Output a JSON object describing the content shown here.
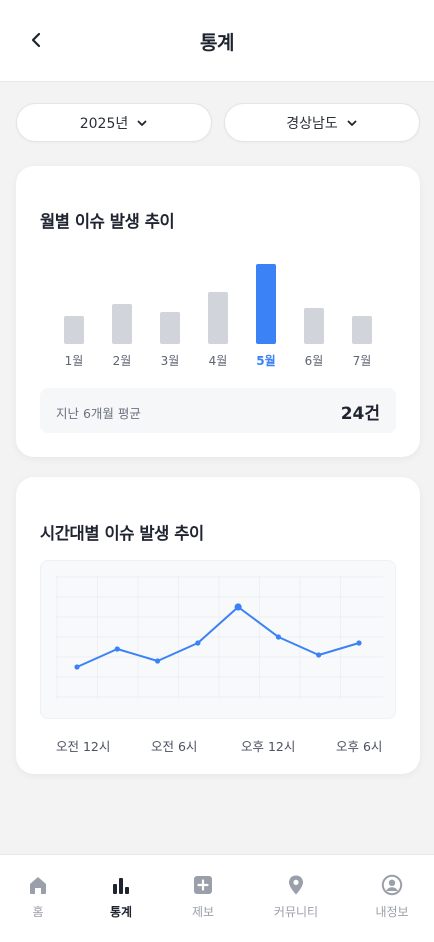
{
  "header": {
    "title": "통계"
  },
  "filters": {
    "year": "2025년",
    "region": "경상남도"
  },
  "monthly_card": {
    "title": "월별 이슈 발생 추이",
    "average_label": "지난 6개월 평균",
    "average_value": "24건"
  },
  "hourly_card": {
    "title": "시간대별 이슈 발생 추이"
  },
  "colors": {
    "accent": "#3b82f6",
    "bar_default": "#d1d5db",
    "month_label": "#5f6470"
  },
  "chart_data": [
    {
      "type": "bar",
      "categories": [
        "1월",
        "2월",
        "3월",
        "4월",
        "5월",
        "6월",
        "7월"
      ],
      "values": [
        14,
        20,
        16,
        26,
        40,
        18,
        14
      ],
      "highlighted": "5월",
      "ylim": [
        0,
        40
      ],
      "grid": false,
      "title": "월별 이슈 발생 추이",
      "xlabel": "",
      "ylabel": ""
    },
    {
      "type": "line",
      "x_labels": [
        "오전 12시",
        "오전 6시",
        "오후 12시",
        "오후 6시"
      ],
      "values": [
        10,
        16,
        12,
        18,
        30,
        20,
        14,
        18
      ],
      "ylim": [
        0,
        40
      ],
      "grid": true,
      "title": "시간대별 이슈 발생 추이",
      "xlabel": "",
      "ylabel": ""
    }
  ],
  "bottom_nav": [
    {
      "label": "홈",
      "icon": "home-icon",
      "active": false
    },
    {
      "label": "통계",
      "icon": "bar-chart-icon",
      "active": true
    },
    {
      "label": "제보",
      "icon": "plus-square-icon",
      "active": false
    },
    {
      "label": "커뮤니티",
      "icon": "map-pin-icon",
      "active": false
    },
    {
      "label": "내정보",
      "icon": "user-circle-icon",
      "active": false
    }
  ]
}
